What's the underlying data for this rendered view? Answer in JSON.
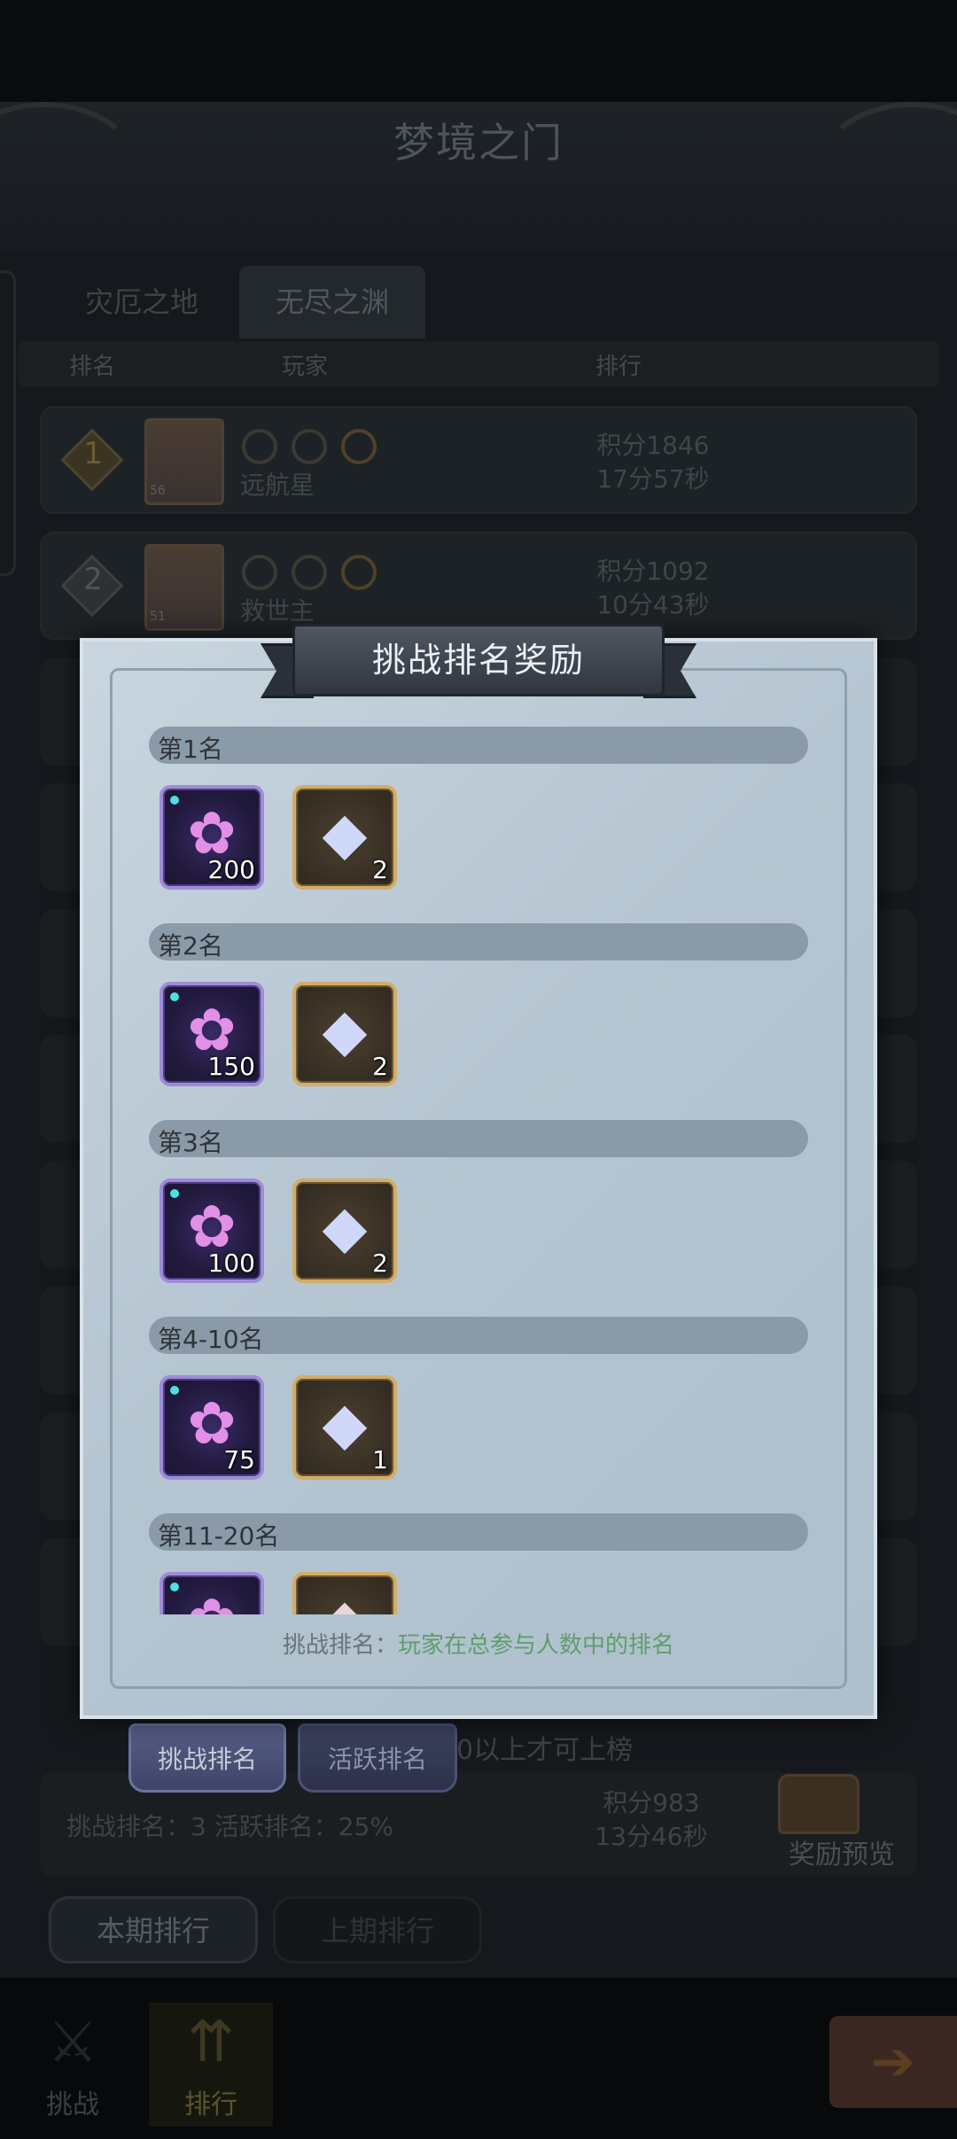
{
  "background": {
    "title": "梦境之门",
    "tabs": [
      "灾厄之地",
      "无尽之渊"
    ],
    "columns": {
      "rank": "排名",
      "player": "玩家",
      "ranking": "排行"
    },
    "rows": [
      {
        "rank": "1",
        "level": "56",
        "name": "远航星",
        "score": "积分1846",
        "time": "17分57秒"
      },
      {
        "rank": "2",
        "level": "51",
        "name": "救世主",
        "score": "积分1092",
        "time": "10分43秒"
      }
    ],
    "note": "0以上才可上榜",
    "sub_tabs": {
      "challenge": "挑战排名",
      "active": "活跃排名"
    },
    "my_rank": {
      "text": "挑战排名：3   活跃排名：25%",
      "score": "积分983",
      "time": "13分46秒"
    },
    "reward_preview": "奖励预览",
    "period": {
      "current": "本期排行",
      "previous": "上期排行"
    },
    "nav": {
      "challenge": "挑战",
      "ranking": "排行"
    }
  },
  "modal": {
    "title": "挑战排名奖励",
    "tiers": [
      {
        "label": "第1名",
        "flower_qty": "200",
        "crystal_qty": "2"
      },
      {
        "label": "第2名",
        "flower_qty": "150",
        "crystal_qty": "2"
      },
      {
        "label": "第3名",
        "flower_qty": "100",
        "crystal_qty": "2"
      },
      {
        "label": "第4-10名",
        "flower_qty": "75",
        "crystal_qty": "1"
      },
      {
        "label": "第11-20名",
        "flower_qty": "",
        "crystal_qty": ""
      }
    ],
    "footer_key": "挑战排名：",
    "footer_value": "玩家在总参与人数中的排名"
  },
  "icons": {
    "flower": "flower-item-icon",
    "crystal": "crystal-item-icon",
    "chest": "treasure-chest-icon"
  },
  "colors": {
    "accent_green": "#5e9e6a",
    "flower_border": "#9f8bd8",
    "crystal_border": "#d3ac68"
  }
}
